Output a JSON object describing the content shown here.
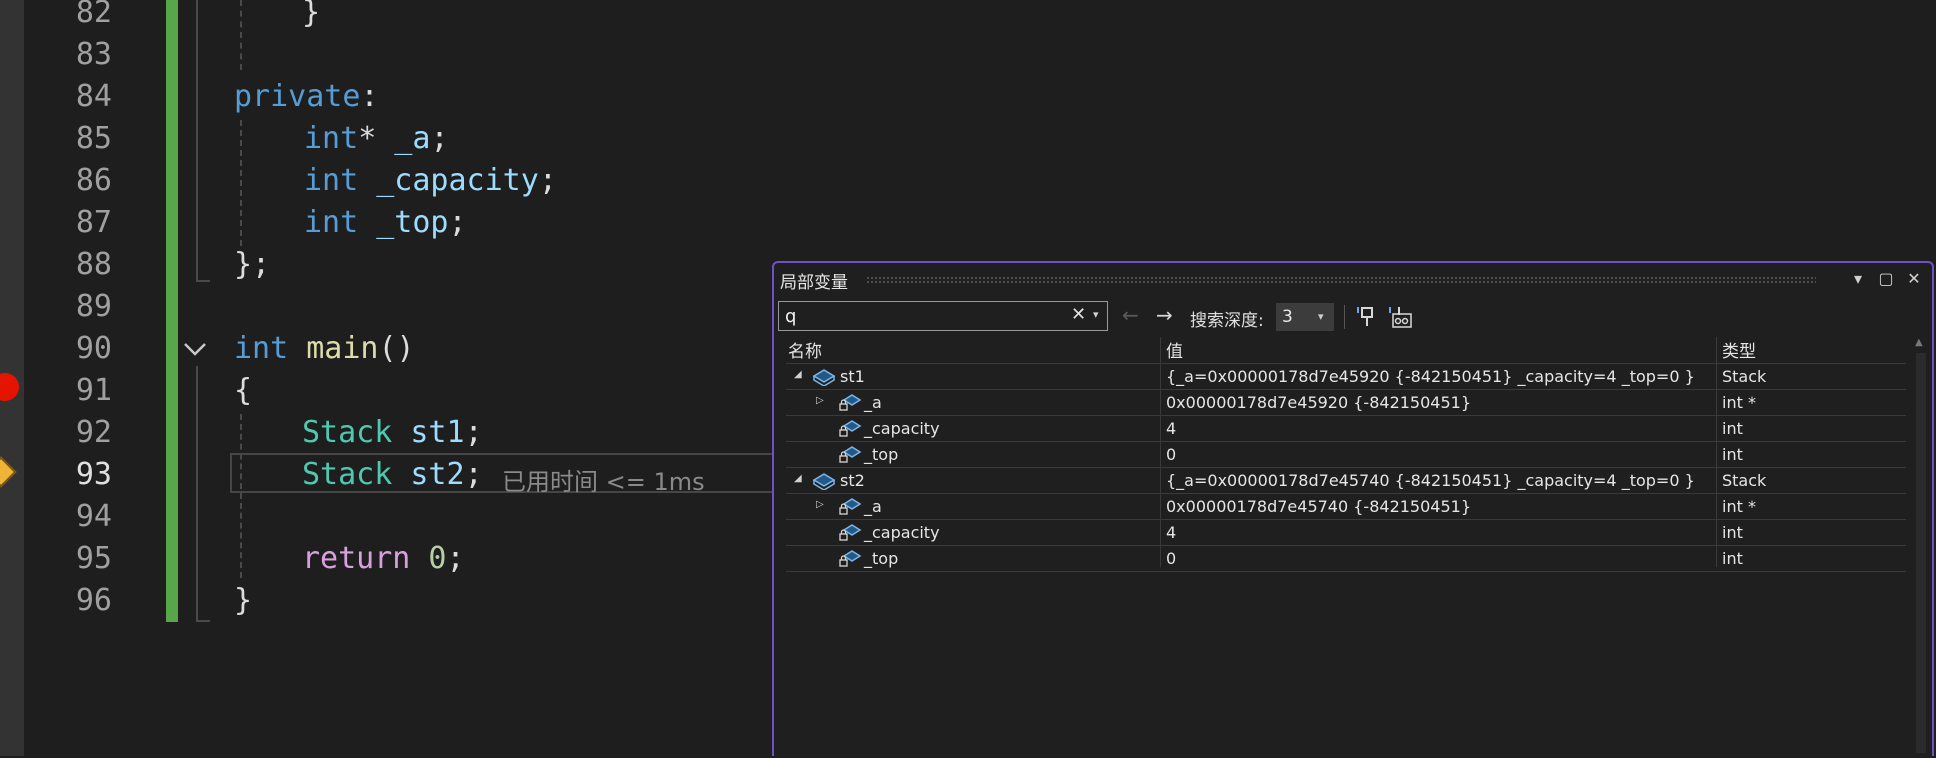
{
  "editor": {
    "line_numbers": [
      "82",
      "83",
      "84",
      "85",
      "86",
      "87",
      "88",
      "89",
      "90",
      "91",
      "92",
      "93",
      "94",
      "95",
      "96"
    ],
    "line82": {
      "brace": "}"
    },
    "line84": {
      "kw": "private",
      "colon": ":"
    },
    "line85": {
      "type": "int",
      "star": "*",
      "name": " _a",
      "semi": ";"
    },
    "line86": {
      "type": "int",
      "name": " _capacity",
      "semi": ";"
    },
    "line87": {
      "type": "int",
      "name": " _top",
      "semi": ";"
    },
    "line88": {
      "text": "};"
    },
    "line90": {
      "type": "int",
      "fn": " main",
      "parens": "()"
    },
    "line91": {
      "brace": "{"
    },
    "line92": {
      "type": "Stack",
      "var": " st1",
      "semi": ";"
    },
    "line93": {
      "type": "Stack",
      "var": " st2",
      "semi": ";"
    },
    "line95": {
      "kw": "return",
      "num": " 0",
      "semi": ";"
    },
    "line96": {
      "brace": "}"
    },
    "perf_tip": "已用时间 <= 1ms"
  },
  "locals": {
    "title": "局部变量",
    "buttons": {
      "dropdown": "▾",
      "maximize": "▢",
      "close": "✕"
    },
    "search": {
      "value": "q",
      "clear": "✕",
      "dropdown": "▾"
    },
    "nav": {
      "back": "←",
      "forward": "→"
    },
    "depth": {
      "label": "搜索深度:",
      "value": "3",
      "caret": "▾"
    },
    "columns": {
      "name": "名称",
      "value": "值",
      "type": "类型"
    },
    "rows": [
      {
        "name": "st1",
        "value": "{_a=0x00000178d7e45920 {-842150451} _capacity=4 _top=0 }",
        "type": "Stack",
        "expander": "◢"
      },
      {
        "name": "_a",
        "value": "0x00000178d7e45920 {-842150451}",
        "type": "int *",
        "expander": "▷"
      },
      {
        "name": "_capacity",
        "value": "4",
        "type": "int"
      },
      {
        "name": "_top",
        "value": "0",
        "type": "int"
      },
      {
        "name": "st2",
        "value": "{_a=0x00000178d7e45740 {-842150451} _capacity=4 _top=0 }",
        "type": "Stack",
        "expander": "◢"
      },
      {
        "name": "_a",
        "value": "0x00000178d7e45740 {-842150451}",
        "type": "int *",
        "expander": "▷"
      },
      {
        "name": "_capacity",
        "value": "4",
        "type": "int"
      },
      {
        "name": "_top",
        "value": "0",
        "type": "int"
      }
    ]
  },
  "colors": {
    "accent_border": "#6e52c4",
    "change_bar": "#57a64a",
    "breakpoint": "#e51400",
    "instruction_pointer": "#f0b437"
  },
  "icons": {
    "breakpoint": "breakpoint-icon",
    "instruction_pointer": "instruction-pointer-icon",
    "fold": "chevron-down-icon",
    "struct_var": "struct-variable-icon",
    "private_field": "private-field-icon",
    "pin": "pin-icon",
    "hex_view": "hex-display-icon"
  }
}
